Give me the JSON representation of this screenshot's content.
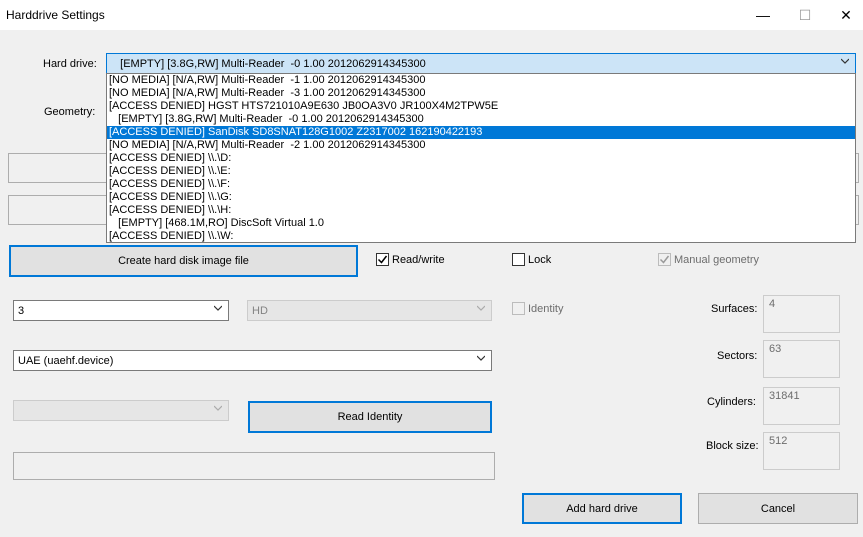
{
  "window": {
    "title": "Harddrive Settings",
    "minimize": "—",
    "maximize": "☐",
    "close": "✕"
  },
  "labels": {
    "hard_drive": "Hard drive:",
    "geometry": "Geometry:",
    "surfaces": "Surfaces:",
    "sectors": "Sectors:",
    "cylinders": "Cylinders:",
    "block_size": "Block size:"
  },
  "hard_drive": {
    "selected": "   [EMPTY] [3.8G,RW] Multi-Reader  -0 1.00 2012062914345300",
    "options": [
      "[NO MEDIA] [N/A,RW] Multi-Reader  -1 1.00 2012062914345300",
      "[NO MEDIA] [N/A,RW] Multi-Reader  -3 1.00 2012062914345300",
      "[ACCESS DENIED] HGST HTS721010A9E630 JB0OA3V0 JR100X4M2TPW5E",
      "   [EMPTY] [3.8G,RW] Multi-Reader  -0 1.00 2012062914345300",
      "[ACCESS DENIED] SanDisk SD8SNAT128G1002 Z2317002 162190422193",
      "[NO MEDIA] [N/A,RW] Multi-Reader  -2 1.00 2012062914345300",
      "[ACCESS DENIED] \\\\.\\D:",
      "[ACCESS DENIED] \\\\.\\E:",
      "[ACCESS DENIED] \\\\.\\F:",
      "[ACCESS DENIED] \\\\.\\G:",
      "[ACCESS DENIED] \\\\.\\H:",
      "   [EMPTY] [468.1M,RO] DiscSoft Virtual 1.0",
      "[ACCESS DENIED] \\\\.\\W:"
    ],
    "highlighted_index": 4
  },
  "buttons": {
    "create_image": "Create hard disk image file",
    "read_identity": "Read Identity",
    "add_hard_drive": "Add hard drive",
    "cancel": "Cancel"
  },
  "checkboxes": {
    "read_write": {
      "label": "Read/write",
      "checked": true
    },
    "lock": {
      "label": "Lock",
      "checked": false
    },
    "manual_geometry": {
      "label": "Manual geometry",
      "checked": true
    },
    "identity": {
      "label": "Identity",
      "checked": false
    }
  },
  "combos": {
    "unit": "3",
    "type": "HD",
    "device": "UAE (uaehf.device)",
    "identity_select": ""
  },
  "fields": {
    "surfaces": "4",
    "sectors": "63",
    "cylinders": "31841",
    "block_size": "512"
  }
}
